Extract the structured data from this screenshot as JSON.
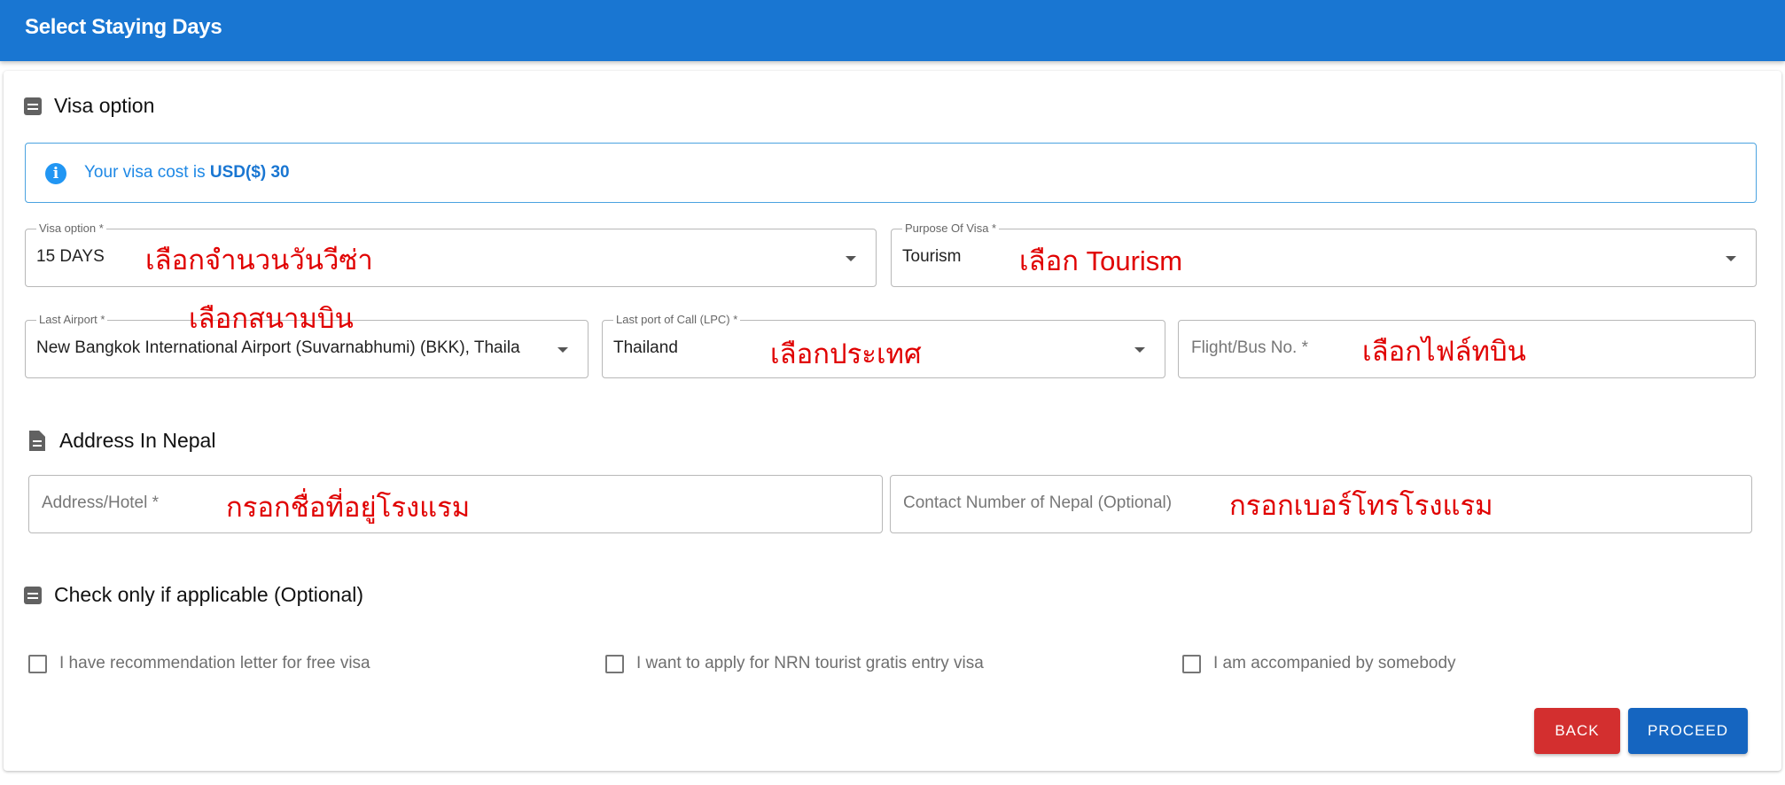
{
  "header": {
    "title": "Select Staying Days"
  },
  "visa_section": {
    "heading": "Visa option"
  },
  "alert": {
    "icon": "info-icon",
    "prefix": "Your visa cost is",
    "amount": "USD($) 30"
  },
  "fields": {
    "visa_option": {
      "label": "Visa option *",
      "value": "15 DAYS"
    },
    "purpose": {
      "label": "Purpose Of Visa *",
      "value": "Tourism"
    },
    "last_airport": {
      "label": "Last Airport *",
      "value": "New Bangkok International Airport (Suvarnabhumi) (BKK), Thaila"
    },
    "last_port": {
      "label": "Last port of Call (LPC) *",
      "value": "Thailand"
    },
    "flight": {
      "placeholder": "Flight/Bus No. *"
    },
    "address": {
      "placeholder": "Address/Hotel *"
    },
    "contact": {
      "placeholder": "Contact Number of Nepal (Optional)"
    }
  },
  "address_section": {
    "heading": "Address In Nepal"
  },
  "optional_section": {
    "heading": "Check only if applicable (Optional)"
  },
  "checkboxes": [
    {
      "label": "I have recommendation letter for free visa",
      "checked": false
    },
    {
      "label": "I want to apply for NRN tourist gratis entry visa",
      "checked": false
    },
    {
      "label": "I am accompanied by somebody",
      "checked": false
    }
  ],
  "annotations": {
    "visa_days": "เลือกจำนวนวันวีซ่า",
    "tourism": "เลือก  Tourism",
    "airport": "เลือกสนามบิน",
    "country": "เลือกประเทศ",
    "flight": "เลือกไฟล์ทบิน",
    "hotel": "กรอกชื่อที่อยู่โรงแรม",
    "phone": "กรอกเบอร์โทรโรงแรม"
  },
  "buttons": {
    "back": "BACK",
    "proceed": "PROCEED"
  },
  "colors": {
    "header": "#1976d2",
    "back": "#d32f2f",
    "proceed": "#1565c0",
    "annotation": "#e00000",
    "info": "#2196f3"
  }
}
